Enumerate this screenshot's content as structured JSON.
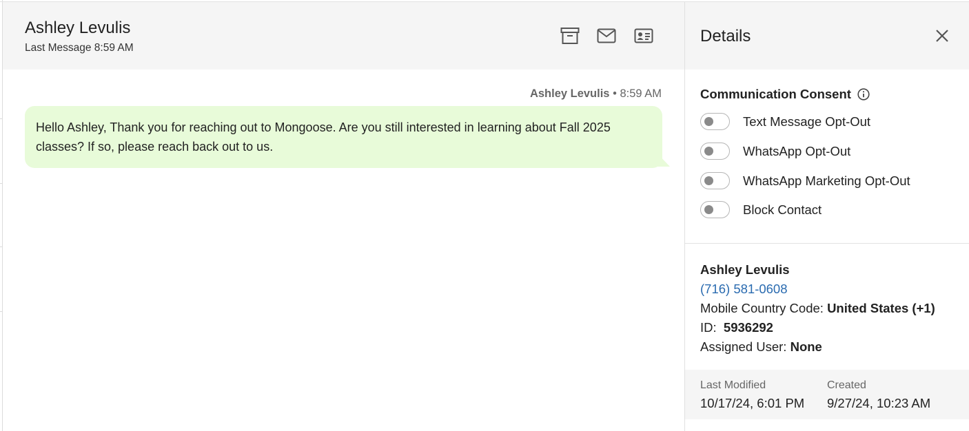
{
  "conversation": {
    "contact_name": "Ashley Levulis",
    "last_message": "Last Message 8:59 AM",
    "header_icons": [
      "archive-icon",
      "mail-icon",
      "contact-card-icon"
    ],
    "message": {
      "sender": "Ashley Levulis",
      "separator": " • ",
      "time": "8:59 AM",
      "text": "Hello Ashley, Thank you for reaching out to Mongoose. Are you still interested in learning about Fall 2025 classes? If so, please reach back out to us."
    }
  },
  "details": {
    "title": "Details",
    "consent_title": "Communication Consent",
    "toggles": [
      {
        "label": "Text Message Opt-Out",
        "on": false
      },
      {
        "label": "WhatsApp Opt-Out",
        "on": false
      },
      {
        "label": "WhatsApp Marketing Opt-Out",
        "on": false
      },
      {
        "label": "Block Contact",
        "on": false
      }
    ],
    "contact": {
      "name": "Ashley Levulis",
      "phone": "(716) 581-0608",
      "country_label": "Mobile Country Code: ",
      "country_value": "United States (+1)",
      "id_label": "ID:  ",
      "id_value": "5936292",
      "assigned_label": "Assigned User: ",
      "assigned_value": "None"
    },
    "last_modified_label": "Last Modified",
    "last_modified_value": "10/17/24, 6:01 PM",
    "created_label": "Created",
    "created_value": "9/27/24, 10:23 AM"
  },
  "colors": {
    "bubble": "#e8fbd9",
    "header_bg": "#f5f5f5",
    "link": "#2a6bb0"
  }
}
